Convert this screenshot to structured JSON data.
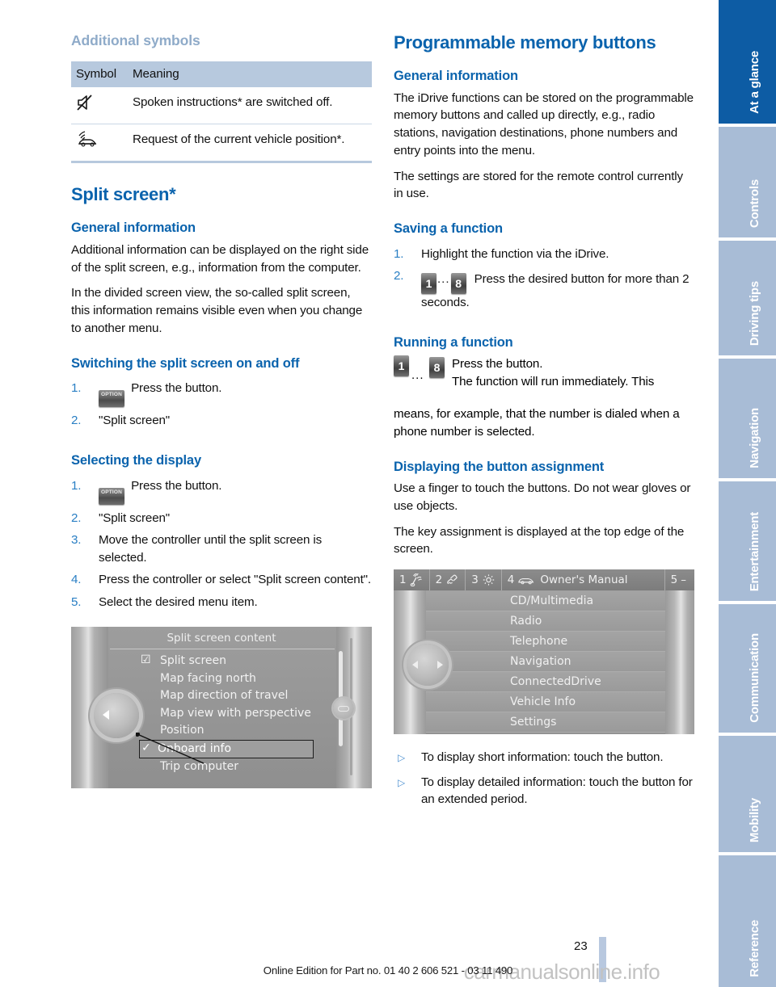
{
  "left_column": {
    "additional_symbols": {
      "heading": "Additional symbols",
      "table": {
        "columns": [
          "Symbol",
          "Meaning"
        ],
        "rows": [
          {
            "icon": "muted-speaker-icon",
            "meaning": "Spoken instructions* are switched off."
          },
          {
            "icon": "vehicle-position-icon",
            "meaning": "Request of the current vehicle position*."
          }
        ]
      }
    },
    "split_screen": {
      "heading": "Split screen*",
      "general_information": {
        "heading": "General information",
        "paragraphs": [
          "Additional information can be displayed on the right side of the split screen, e.g., information from the computer.",
          "In the divided screen view, the so-called split screen, this information remains visible even when you change to another menu."
        ]
      },
      "switching": {
        "heading": "Switching the split screen on and off",
        "steps": [
          {
            "num": "1.",
            "button": "OPTION",
            "text": "Press the button."
          },
          {
            "num": "2.",
            "text": "\"Split screen\""
          }
        ]
      },
      "selecting": {
        "heading": "Selecting the display",
        "steps": [
          {
            "num": "1.",
            "button": "OPTION",
            "text": "Press the button."
          },
          {
            "num": "2.",
            "text": "\"Split screen\""
          },
          {
            "num": "3.",
            "text": "Move the controller until the split screen is selected."
          },
          {
            "num": "4.",
            "text": "Press the controller or select \"Split screen content\"."
          },
          {
            "num": "5.",
            "text": "Select the desired menu item."
          }
        ]
      },
      "screenshot": {
        "title": "Split screen content",
        "items": [
          {
            "label": "Split screen",
            "state": "checkbox"
          },
          {
            "label": "Map facing north",
            "state": "none"
          },
          {
            "label": "Map direction of travel",
            "state": "none"
          },
          {
            "label": "Map view with perspective",
            "state": "none"
          },
          {
            "label": "Position",
            "state": "none"
          },
          {
            "label": "Onboard info",
            "state": "selected"
          },
          {
            "label": "Trip computer",
            "state": "none"
          }
        ]
      }
    }
  },
  "right_column": {
    "programmable_memory_buttons": {
      "heading": "Programmable memory buttons",
      "general_information": {
        "heading": "General information",
        "paragraphs": [
          "The iDrive functions can be stored on the programmable memory buttons and called up directly, e.g., radio stations, navigation destinations, phone numbers and entry points into the menu.",
          "The settings are stored for the remote control currently in use."
        ]
      },
      "saving_a_function": {
        "heading": "Saving a function",
        "steps": [
          {
            "num": "1.",
            "text": "Highlight the function via the iDrive."
          },
          {
            "num": "2.",
            "btn_first": "1",
            "btn_last": "8",
            "dots": "...",
            "text": "Press the desired button for more than 2 seconds."
          }
        ]
      },
      "running_a_function": {
        "heading": "Running a function",
        "btn_first": "1",
        "btn_last": "8",
        "dots": "...",
        "line1": "Press the button.",
        "line2": "The function will run immediately. This",
        "line3": "means, for example, that the number is dialed when a phone number is selected."
      },
      "displaying_button_assignment": {
        "heading": "Displaying the button assignment",
        "paragraphs": [
          "Use a finger to touch the buttons. Do not wear gloves or use objects.",
          "The key assignment is displayed at the top edge of the screen."
        ],
        "bullets": [
          "To display short information: touch the button.",
          "To display detailed information: touch the button for an extended period."
        ]
      },
      "screenshot": {
        "topbar": [
          {
            "num": "1",
            "icon": "signal-waves-icon",
            "label": ""
          },
          {
            "num": "2",
            "icon": "phone-handset-icon",
            "label": ""
          },
          {
            "num": "3",
            "icon": "gear-icon",
            "label": ""
          },
          {
            "num": "4",
            "icon": "car-icon",
            "label": "Owner's Manual"
          },
          {
            "num": "5",
            "icon": "",
            "label": "–"
          }
        ],
        "menu_items": [
          "CD/Multimedia",
          "Radio",
          "Telephone",
          "Navigation",
          "ConnectedDrive",
          "Vehicle Info",
          "Settings"
        ]
      }
    }
  },
  "sidebar": {
    "tabs": [
      {
        "label": "At a glance",
        "active": true
      },
      {
        "label": "Controls",
        "active": false
      },
      {
        "label": "Driving tips",
        "active": false
      },
      {
        "label": "Navigation",
        "active": false
      },
      {
        "label": "Entertainment",
        "active": false
      },
      {
        "label": "Communication",
        "active": false
      },
      {
        "label": "Mobility",
        "active": false
      },
      {
        "label": "Reference",
        "active": false
      }
    ]
  },
  "footer": {
    "page_number": "23",
    "edition_line": "Online Edition for Part no. 01 40 2 606 521 - 03 11 490",
    "watermark": "carmanualsonline.info"
  },
  "colors": {
    "heading_blue": "#0a63ad",
    "pale_heading_blue": "#8fabc9",
    "table_header_bg": "#b7c9de",
    "sidebar_active": "#0d5ca4",
    "sidebar_inactive": "#a8bcd6",
    "step_number": "#2a7fc4",
    "bullet_marker": "#4b8fd0"
  }
}
